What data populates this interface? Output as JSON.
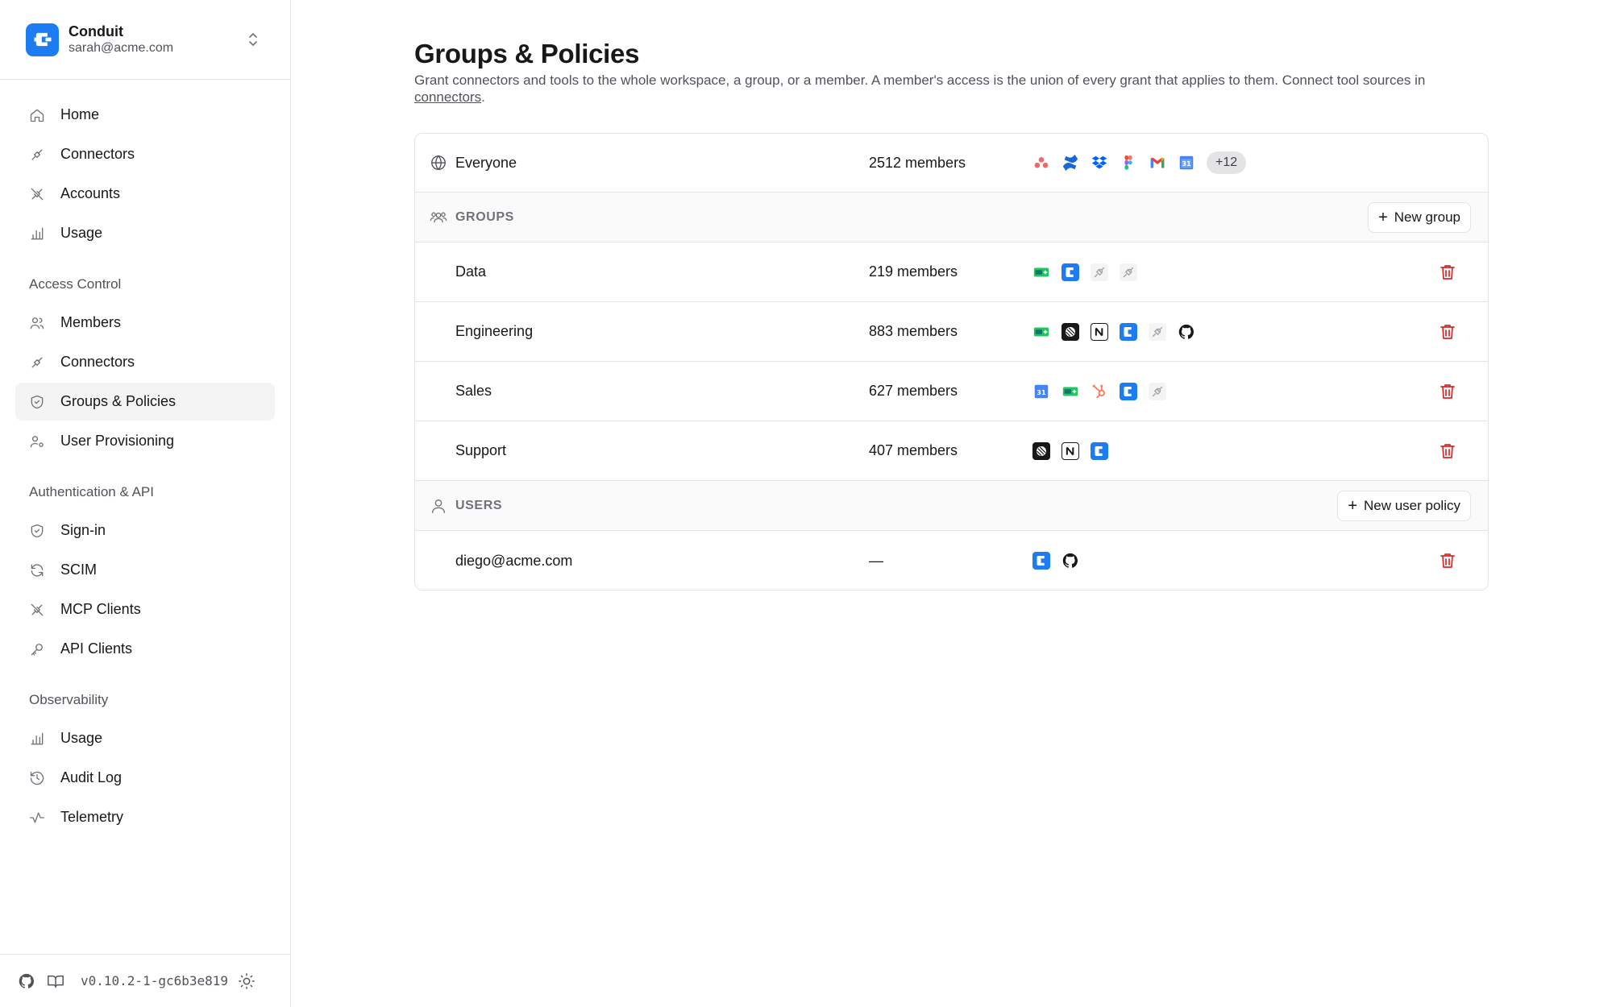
{
  "org": {
    "name": "Conduit",
    "email": "sarah@acme.com"
  },
  "nav": {
    "main": [
      {
        "label": "Home"
      },
      {
        "label": "Connectors"
      },
      {
        "label": "Accounts"
      },
      {
        "label": "Usage"
      }
    ],
    "sections": [
      {
        "title": "Access Control",
        "items": [
          {
            "label": "Members"
          },
          {
            "label": "Connectors"
          },
          {
            "label": "Groups & Policies",
            "active": true
          },
          {
            "label": "User Provisioning"
          }
        ]
      },
      {
        "title": "Authentication & API",
        "items": [
          {
            "label": "Sign-in"
          },
          {
            "label": "SCIM"
          },
          {
            "label": "MCP Clients"
          },
          {
            "label": "API Clients"
          }
        ]
      },
      {
        "title": "Observability",
        "items": [
          {
            "label": "Usage"
          },
          {
            "label": "Audit Log"
          },
          {
            "label": "Telemetry"
          }
        ]
      }
    ]
  },
  "footer": {
    "version": "v0.10.2-1-gc6b3e819"
  },
  "page": {
    "title": "Groups & Policies",
    "description": "Grant connectors and tools to the whole workspace, a group, or a member. A member's access is the union of every grant that applies to them. Connect tool sources in ",
    "description_link": "connectors",
    "description_end": "."
  },
  "everyone": {
    "name": "Everyone",
    "members": "2512 members",
    "more": "+12",
    "icons": [
      "asana-icon",
      "confluence-icon",
      "dropbox-icon",
      "figma-icon",
      "gmail-icon",
      "google-calendar-icon"
    ]
  },
  "groups_section": {
    "label": "GROUPS",
    "new_button": "New group"
  },
  "groups": [
    {
      "name": "Data",
      "members": "219 members",
      "icons": [
        "green-sheet-icon",
        "conduit-icon",
        "plug-icon",
        "plug-icon"
      ]
    },
    {
      "name": "Engineering",
      "members": "883 members",
      "icons": [
        "green-sheet-icon",
        "linear-icon",
        "notion-icon",
        "conduit-icon",
        "plug-icon",
        "github-icon"
      ]
    },
    {
      "name": "Sales",
      "members": "627 members",
      "icons": [
        "google-calendar-icon",
        "green-sheet-icon",
        "hubspot-icon",
        "conduit-icon",
        "plug-icon"
      ]
    },
    {
      "name": "Support",
      "members": "407 members",
      "icons": [
        "linear-icon",
        "notion-icon",
        "conduit-icon"
      ]
    }
  ],
  "users_section": {
    "label": "USERS",
    "new_button": "New user policy"
  },
  "users": [
    {
      "name": "diego@acme.com",
      "members": "—",
      "icons": [
        "conduit-icon",
        "github-icon"
      ]
    }
  ],
  "colors": {
    "accent": "#1d7cf2",
    "danger": "#dc2626",
    "active_bg": "#f4f4f5"
  }
}
